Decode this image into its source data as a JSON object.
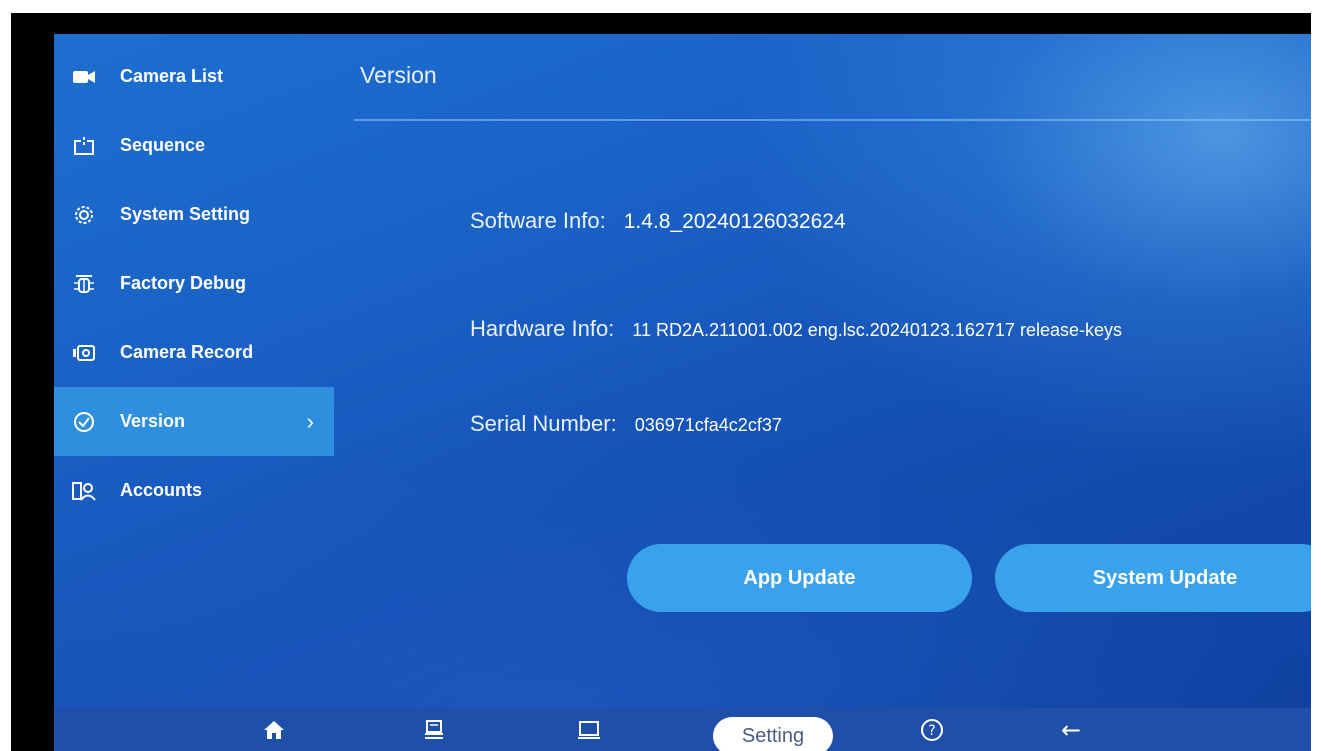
{
  "sidebar": {
    "items": [
      {
        "label": "Camera List",
        "icon": "camera-icon"
      },
      {
        "label": "Sequence",
        "icon": "sequence-icon"
      },
      {
        "label": "System Setting",
        "icon": "gear-icon"
      },
      {
        "label": "Factory Debug",
        "icon": "bug-icon"
      },
      {
        "label": "Camera Record",
        "icon": "record-icon"
      },
      {
        "label": "Version",
        "icon": "version-check-icon",
        "active": true,
        "chevron": "›"
      },
      {
        "label": "Accounts",
        "icon": "accounts-icon"
      }
    ]
  },
  "header": {
    "title": "Version"
  },
  "info": {
    "software_label": "Software Info:",
    "software_value": "1.4.8_20240126032624",
    "hardware_label": "Hardware Info:",
    "hardware_value": "11 RD2A.211001.002 eng.lsc.20240123.162717 release-keys",
    "serial_label": "Serial Number:",
    "serial_value": "036971cfa4c2cf37"
  },
  "buttons": {
    "app_update": "App Update",
    "system_update": "System Update"
  },
  "bottombar": {
    "setting_label": "Setting",
    "back_glyph": "←",
    "help_glyph": "?"
  },
  "colors": {
    "accent": "#3aa2ea",
    "active_item": "#2f8fdf",
    "bottombar": "#1f4fa8"
  }
}
